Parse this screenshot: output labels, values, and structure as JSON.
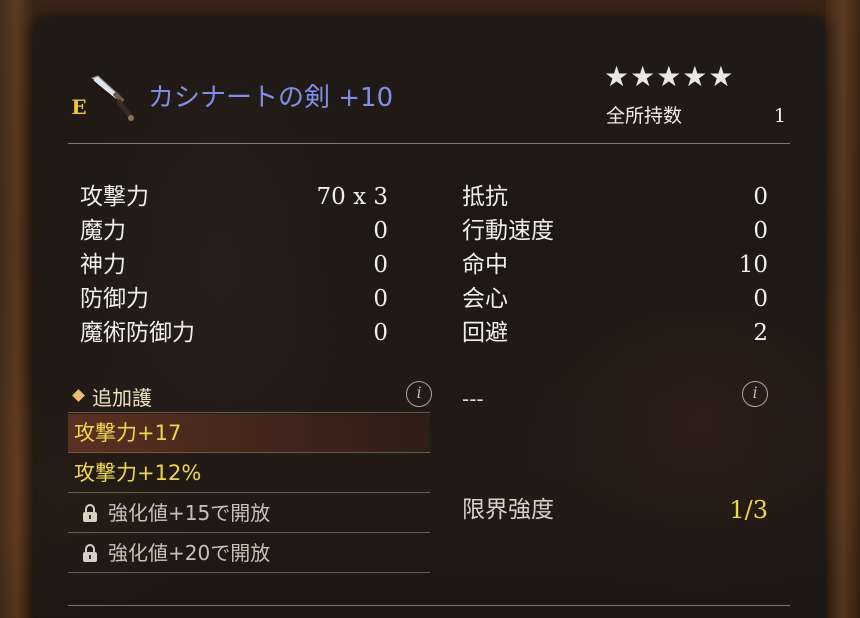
{
  "item": {
    "rank": "E",
    "name": "カシナートの剣 +10",
    "rarity_stars": "★★★★★",
    "owned_label": "全所持数",
    "owned_count": "1"
  },
  "stats_left": [
    {
      "label": "攻撃力",
      "value": "70 x 3"
    },
    {
      "label": "魔力",
      "value": "0"
    },
    {
      "label": "神力",
      "value": "0"
    },
    {
      "label": "防御力",
      "value": "0"
    },
    {
      "label": "魔術防御力",
      "value": "0"
    }
  ],
  "stats_right": [
    {
      "label": "抵抗",
      "value": "0"
    },
    {
      "label": "行動速度",
      "value": "0"
    },
    {
      "label": "命中",
      "value": "10"
    },
    {
      "label": "会心",
      "value": "0"
    },
    {
      "label": "回避",
      "value": "2"
    }
  ],
  "extra_protection": {
    "title": "追加護",
    "info_glyph": "i",
    "right_text": "---"
  },
  "enhancements": [
    {
      "text": "攻撃力+17",
      "locked": false
    },
    {
      "text": "攻撃力+12%",
      "locked": false
    },
    {
      "text": "強化値+15で開放",
      "locked": true
    },
    {
      "text": "強化値+20で開放",
      "locked": true
    }
  ],
  "limit": {
    "label": "限界強度",
    "value": "1/3"
  },
  "colors": {
    "item_name": "#7f8fe8",
    "enhancement_active": "#efd650",
    "rank_badge": "#e8c84a"
  }
}
